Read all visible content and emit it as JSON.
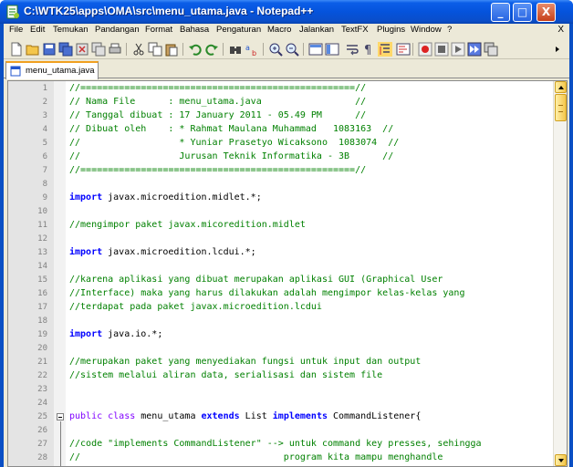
{
  "window": {
    "title": "C:\\WTK25\\apps\\OMA\\src\\menu_utama.java - Notepad++",
    "minimize": "_",
    "maximize": "□",
    "close": "X"
  },
  "menu": {
    "items": [
      "File",
      "Edit",
      "Temukan",
      "Pandangan",
      "Format",
      "Bahasa",
      "Pengaturan",
      "Macro",
      "Jalankan",
      "TextFX",
      "Plugins",
      "Window",
      "?"
    ],
    "close_doc": "X"
  },
  "tab": {
    "label": "menu_utama.java"
  },
  "colors": {
    "comment": "#008000",
    "keyword": "#0000ff",
    "keyword2": "#8000ff",
    "linenum": "#808080"
  },
  "editor": {
    "lines": [
      {
        "num": "1",
        "parts": [
          {
            "t": "//==================================================//",
            "c": "comment"
          }
        ]
      },
      {
        "num": "2",
        "parts": [
          {
            "t": "// Nama File      : menu_utama.java                 //",
            "c": "comment"
          }
        ]
      },
      {
        "num": "3",
        "parts": [
          {
            "t": "// Tanggal dibuat : 17 January 2011 - 05.49 PM      //",
            "c": "comment"
          }
        ]
      },
      {
        "num": "4",
        "parts": [
          {
            "t": "// Dibuat oleh    : * Rahmat Maulana Muhammad   1083163  //",
            "c": "comment"
          }
        ]
      },
      {
        "num": "5",
        "parts": [
          {
            "t": "//                  * Yuniar Prasetyo Wicaksono  1083074  //",
            "c": "comment"
          }
        ]
      },
      {
        "num": "6",
        "parts": [
          {
            "t": "//                  Jurusan Teknik Informatika - 3B      //",
            "c": "comment"
          }
        ]
      },
      {
        "num": "7",
        "parts": [
          {
            "t": "//==================================================//",
            "c": "comment"
          }
        ]
      },
      {
        "num": "8",
        "parts": []
      },
      {
        "num": "9",
        "parts": [
          {
            "t": "import",
            "c": "kw"
          },
          {
            "t": " javax.microedition.midlet.*;",
            "c": "plain"
          }
        ]
      },
      {
        "num": "10",
        "parts": []
      },
      {
        "num": "11",
        "parts": [
          {
            "t": "//mengimpor paket javax.micoredition.midlet",
            "c": "comment"
          }
        ]
      },
      {
        "num": "12",
        "parts": []
      },
      {
        "num": "13",
        "parts": [
          {
            "t": "import",
            "c": "kw"
          },
          {
            "t": " javax.microedition.lcdui.*;",
            "c": "plain"
          }
        ]
      },
      {
        "num": "14",
        "parts": []
      },
      {
        "num": "15",
        "parts": [
          {
            "t": "//karena aplikasi yang dibuat merupakan aplikasi GUI (Graphical User",
            "c": "comment"
          }
        ]
      },
      {
        "num": "16",
        "parts": [
          {
            "t": "//Interface) maka yang harus dilakukan adalah mengimpor kelas-kelas yang",
            "c": "comment"
          }
        ]
      },
      {
        "num": "17",
        "parts": [
          {
            "t": "//terdapat pada paket javax.microedition.lcdui",
            "c": "comment"
          }
        ]
      },
      {
        "num": "18",
        "parts": []
      },
      {
        "num": "19",
        "parts": [
          {
            "t": "import",
            "c": "kw"
          },
          {
            "t": " java.io.*;",
            "c": "plain"
          }
        ]
      },
      {
        "num": "20",
        "parts": []
      },
      {
        "num": "21",
        "parts": [
          {
            "t": "//merupakan paket yang menyediakan fungsi untuk input dan output",
            "c": "comment"
          }
        ]
      },
      {
        "num": "22",
        "parts": [
          {
            "t": "//sistem melalui aliran data, serialisasi dan sistem file",
            "c": "comment"
          }
        ]
      },
      {
        "num": "23",
        "parts": []
      },
      {
        "num": "24",
        "parts": []
      },
      {
        "num": "25",
        "parts": [
          {
            "t": "public class",
            "c": "kw2"
          },
          {
            "t": " menu_utama ",
            "c": "plain"
          },
          {
            "t": "extends",
            "c": "kw"
          },
          {
            "t": " List ",
            "c": "plain"
          },
          {
            "t": "implements",
            "c": "kw"
          },
          {
            "t": " CommandListener{",
            "c": "plain"
          }
        ]
      },
      {
        "num": "26",
        "parts": []
      },
      {
        "num": "27",
        "parts": [
          {
            "t": "//code \"implements CommandListener\" --> untuk command key presses, sehingga",
            "c": "comment"
          }
        ]
      },
      {
        "num": "28",
        "parts": [
          {
            "t": "//                                     program kita mampu menghandle",
            "c": "comment"
          }
        ]
      }
    ]
  }
}
